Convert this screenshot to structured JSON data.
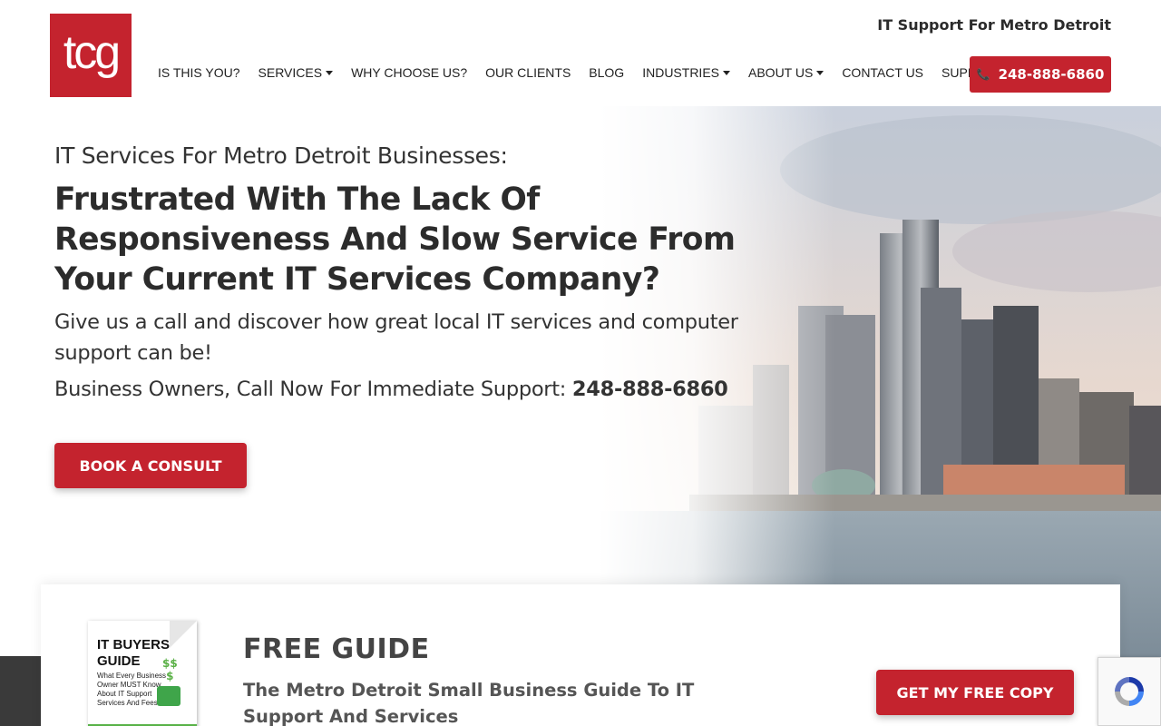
{
  "header": {
    "logo_text": "tcg",
    "tagline": "IT Support For Metro Detroit",
    "nav": [
      {
        "label": "IS THIS YOU?",
        "dropdown": false
      },
      {
        "label": "SERVICES",
        "dropdown": true
      },
      {
        "label": "WHY CHOOSE US?",
        "dropdown": false
      },
      {
        "label": "OUR CLIENTS",
        "dropdown": false
      },
      {
        "label": "BLOG",
        "dropdown": false
      },
      {
        "label": "INDUSTRIES",
        "dropdown": true
      },
      {
        "label": "ABOUT US",
        "dropdown": true
      },
      {
        "label": "CONTACT US",
        "dropdown": false
      },
      {
        "label": "SUPPORT",
        "dropdown": false
      }
    ],
    "phone_button": "248-888-6860"
  },
  "hero": {
    "kicker": "IT Services For Metro Detroit Businesses:",
    "headline": "Frustrated With The Lack Of Responsiveness And Slow Service From Your Current IT Services Company?",
    "sub": "Give us a call and discover how great local IT services and computer support can be!",
    "call_prefix": "Business Owners, Call Now For Immediate Support: ",
    "call_number": "248-888-6860",
    "cta": "BOOK A CONSULT"
  },
  "guide": {
    "book_title": "IT BUYERS GUIDE",
    "book_subtitle": "What Every Business Owner MUST Know About IT Support Services And Fees",
    "title": "FREE GUIDE",
    "subtitle": "The Metro Detroit Small Business Guide To IT Support And Services",
    "cta": "GET MY FREE COPY"
  },
  "colors": {
    "brand_red": "#c4232e",
    "text_dark": "#2c2c2c"
  },
  "icons": {
    "phone": "phone-icon",
    "caret": "caret-down-icon",
    "recaptcha": "recaptcha-icon"
  }
}
